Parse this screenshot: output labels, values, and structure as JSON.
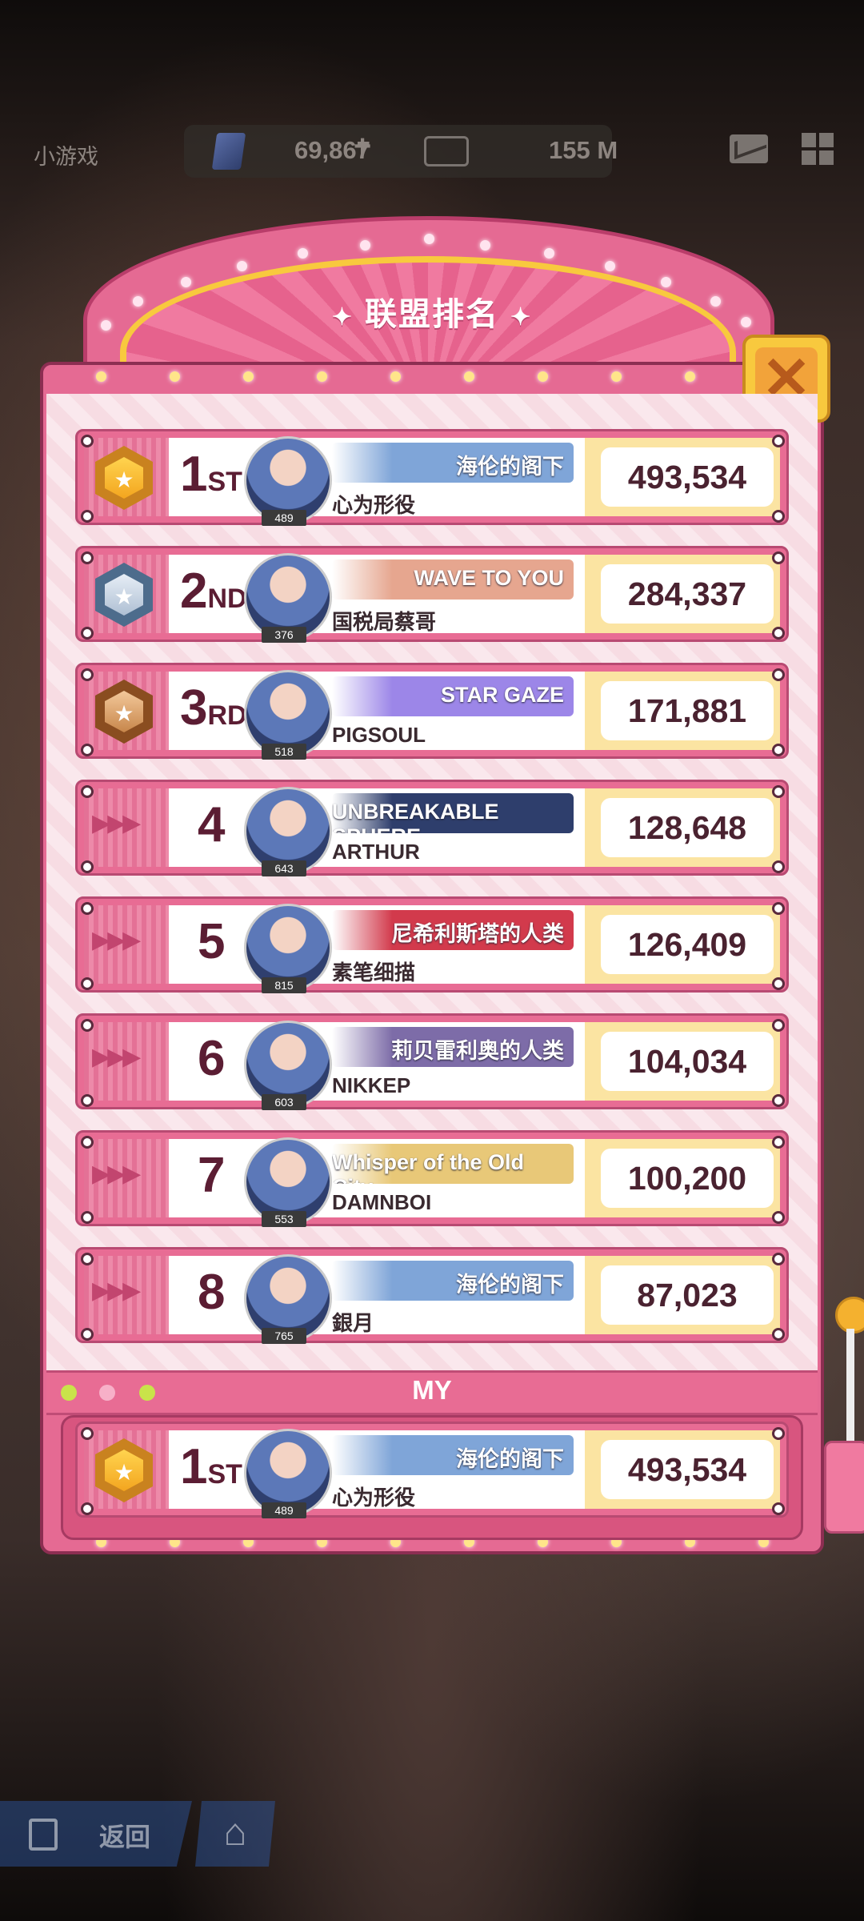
{
  "topbar": {
    "title": "小游戏",
    "gems": "69,867",
    "gems_plus": "+",
    "tickets": "155 M"
  },
  "panel": {
    "title": "联盟排名",
    "close_label": "✕",
    "my_label": "MY"
  },
  "rows": [
    {
      "rank": "1",
      "suffix": "ST",
      "medal": "gold",
      "level": "489",
      "name": "心为形役",
      "banner": "海伦的阁下",
      "score": "493,534",
      "banner_color": "#7fa5d8"
    },
    {
      "rank": "2",
      "suffix": "ND",
      "medal": "silver",
      "level": "376",
      "name": "国税局蔡哥",
      "banner": "WAVE TO YOU",
      "score": "284,337",
      "banner_color": "#e6a68f"
    },
    {
      "rank": "3",
      "suffix": "RD",
      "medal": "bronze",
      "level": "518",
      "name": "PIGSOUL",
      "banner": "STAR GAZE",
      "score": "171,881",
      "banner_color": "#9c86e8"
    },
    {
      "rank": "4",
      "suffix": "",
      "medal": "",
      "level": "643",
      "name": "ARTHUR",
      "banner": "UNBREAKABLE SPHERE",
      "score": "128,648",
      "banner_color": "#2e3e6c"
    },
    {
      "rank": "5",
      "suffix": "",
      "medal": "",
      "level": "815",
      "name": "素笔细描",
      "banner": "尼希利斯塔的人类",
      "score": "126,409",
      "banner_color": "#d23a4c"
    },
    {
      "rank": "6",
      "suffix": "",
      "medal": "",
      "level": "603",
      "name": "NIKKEP",
      "banner": "莉贝雷利奥的人类",
      "score": "104,034",
      "banner_color": "#7d6ca8"
    },
    {
      "rank": "7",
      "suffix": "",
      "medal": "",
      "level": "553",
      "name": "DAMNBOI",
      "banner": "Whisper of the Old City",
      "score": "100,200",
      "banner_color": "#e8c878"
    },
    {
      "rank": "8",
      "suffix": "",
      "medal": "",
      "level": "765",
      "name": "銀月",
      "banner": "海伦的阁下",
      "score": "87,023",
      "banner_color": "#7fa5d8"
    }
  ],
  "my_row": {
    "rank": "1",
    "suffix": "ST",
    "medal": "gold",
    "level": "489",
    "name": "心为形役",
    "banner": "海伦的阁下",
    "score": "493,534",
    "banner_color": "#7fa5d8"
  },
  "nav": {
    "back_label": "返回"
  },
  "colors": {
    "panel_pink": "#e56a93",
    "gold": "#f8c93e",
    "score_text": "#4a2230"
  }
}
